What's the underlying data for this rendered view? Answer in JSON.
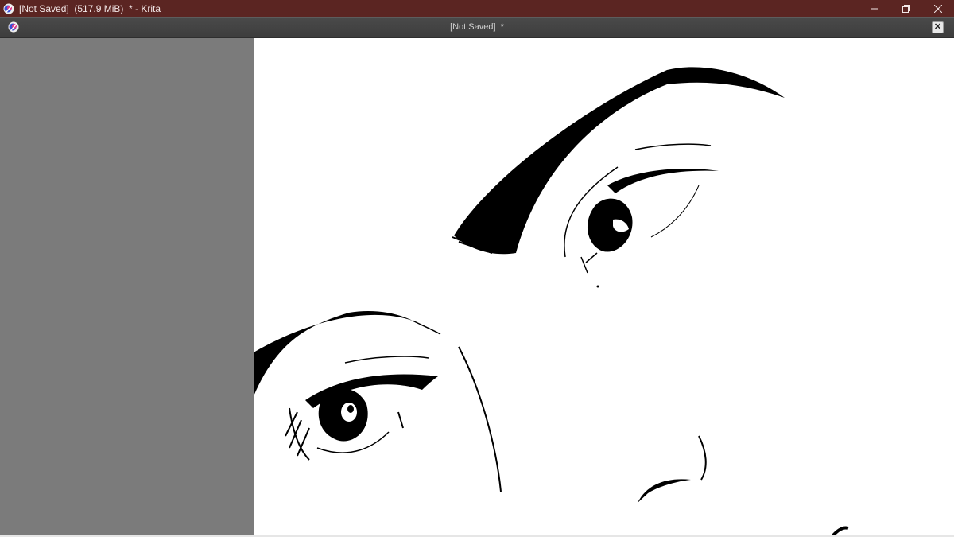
{
  "window": {
    "title": "[Not Saved]  (517.9 MiB)  * - Krita",
    "minimize_icon": "minimize-icon",
    "maximize_icon": "restore-icon",
    "close_icon": "close-icon"
  },
  "document": {
    "title": "[Not Saved]  *",
    "close_icon": "close-icon"
  },
  "canvas": {
    "background": "#ffffff",
    "artwork": "line-art-face-eyes-eyebrows"
  },
  "colors": {
    "titlebar": "#5b2522",
    "docbar": "#444444",
    "workspace": "#7b7b7b"
  }
}
